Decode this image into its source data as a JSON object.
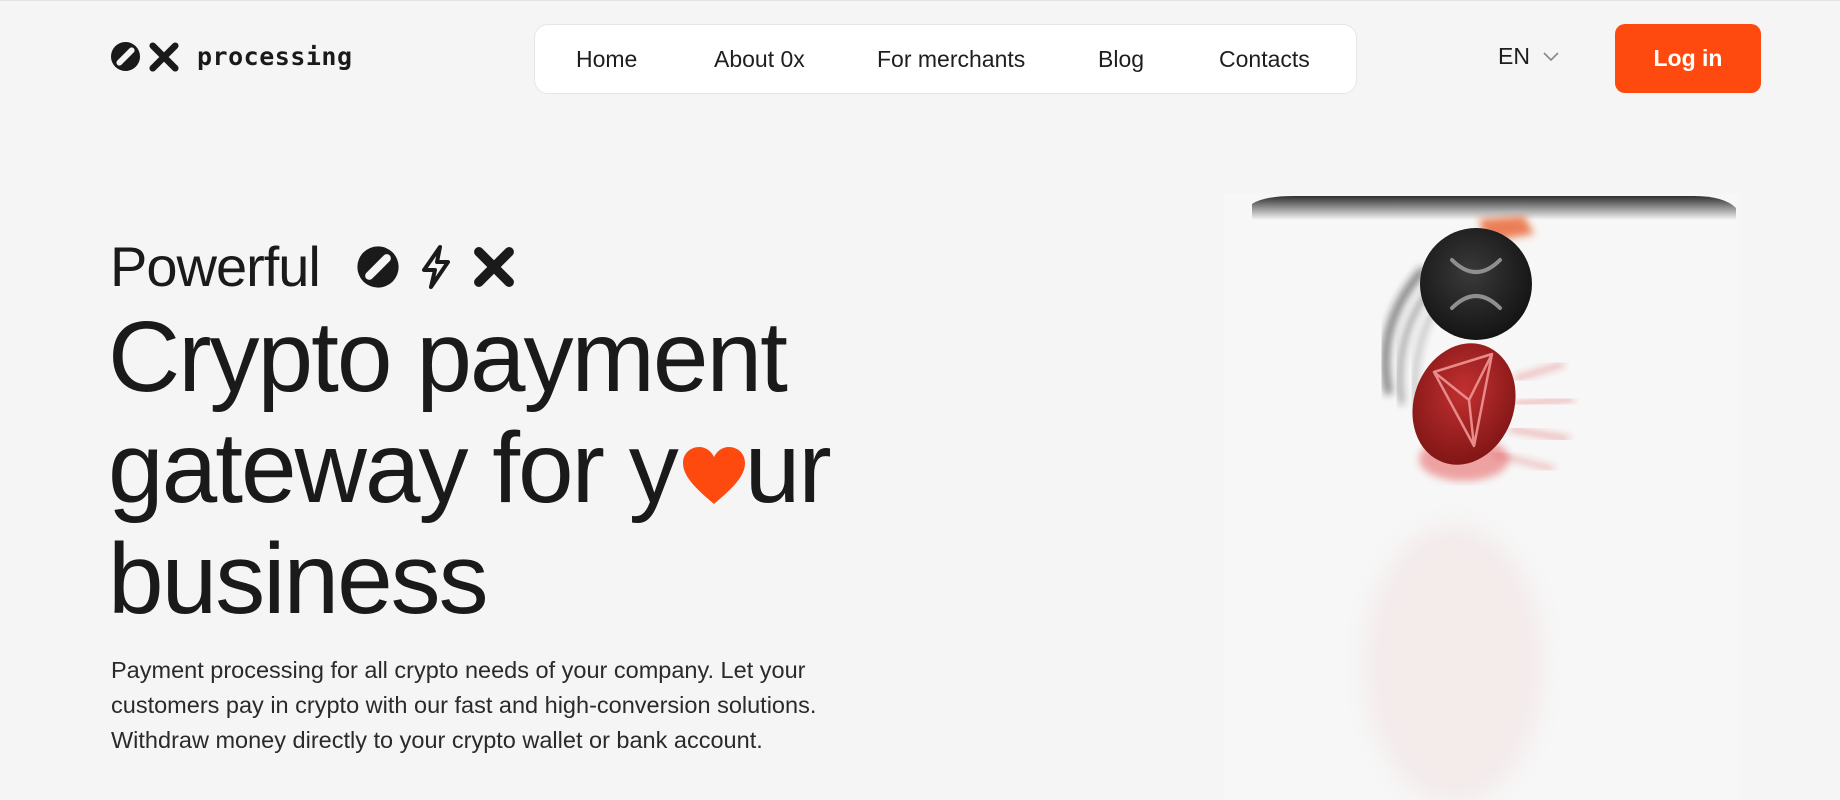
{
  "header": {
    "logo_text": "processing",
    "nav": {
      "items": [
        {
          "label": "Home"
        },
        {
          "label": "About 0x"
        },
        {
          "label": "For merchants"
        },
        {
          "label": "Blog"
        },
        {
          "label": "Contacts"
        }
      ]
    },
    "language": "EN",
    "login_label": "Log in"
  },
  "hero": {
    "eyebrow": "Powerful",
    "line1": "Crypto payment",
    "line2_before": "gateway for y",
    "line2_after": "ur",
    "line3": "business",
    "description": [
      "Payment processing for all crypto needs of your company. Let your",
      "customers pay in crypto with our fast and high-conversion solutions.",
      "Withdraw money directly to your crypto wallet or bank account."
    ]
  },
  "colors": {
    "accent": "#ff4a0f",
    "text": "#1a1a1a",
    "background": "#f5f5f5"
  },
  "icons": {
    "logo": [
      "zero-slash-icon",
      "x-icon"
    ],
    "hero": [
      "zero-slash-icon",
      "lightning-icon",
      "x-icon"
    ],
    "heart": "heart-icon",
    "language": "chevron-down-icon"
  }
}
